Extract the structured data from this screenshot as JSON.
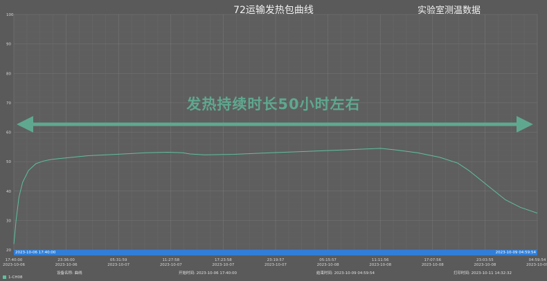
{
  "chart_data": {
    "type": "line",
    "title": "72运输发热包曲线",
    "subtitle": "实验室测温数据",
    "annotation": "发热持续时长50小时左右",
    "ylim": [
      20,
      100
    ],
    "y_ticks": [
      20,
      30,
      40,
      50,
      60,
      70,
      80,
      90,
      100
    ],
    "grid": true,
    "x_ticks": [
      {
        "time": "17:40:00",
        "date": "2023-10-06"
      },
      {
        "time": "23:36:00",
        "date": "2023-10-06"
      },
      {
        "time": "05:31:59",
        "date": "2023-10-07"
      },
      {
        "time": "11:27:58",
        "date": "2023-10-07"
      },
      {
        "time": "17:23:58",
        "date": "2023-10-07"
      },
      {
        "time": "23:19:57",
        "date": "2023-10-07"
      },
      {
        "time": "05:15:57",
        "date": "2023-10-08"
      },
      {
        "time": "11:11:56",
        "date": "2023-10-08"
      },
      {
        "time": "17:07:56",
        "date": "2023-10-08"
      },
      {
        "time": "23:03:55",
        "date": "2023-10-08"
      },
      {
        "time": "04:59:54",
        "date": "2023-10-09"
      }
    ],
    "series": [
      {
        "name": "1-CH08",
        "color": "#5fc0a0",
        "x_hours": [
          0,
          0.3,
          0.7,
          1.2,
          2,
          3,
          4,
          5,
          6,
          8,
          10,
          14,
          18,
          21,
          23,
          24,
          26,
          30,
          35,
          40,
          45,
          48,
          50,
          52,
          55,
          58,
          60.5,
          62,
          63,
          65,
          67,
          69,
          71.33
        ],
        "values": [
          22,
          30,
          38,
          43,
          47,
          49.3,
          50.2,
          50.7,
          51,
          51.5,
          52,
          52.5,
          53,
          53.2,
          53,
          52.6,
          52.3,
          52.5,
          53,
          53.5,
          54,
          54.3,
          54.5,
          54,
          53,
          51.5,
          49.5,
          47,
          45,
          41,
          37,
          34.5,
          32.5
        ]
      }
    ]
  },
  "range_bar": {
    "start": "2023-10-06 17:40:00",
    "end": "2023-10-09 04:59:54"
  },
  "footer": {
    "device": "设备名称: 曲线",
    "start": "开始时间: 2023-10-06 17:40:00",
    "end": "结束时间: 2023-10-09 04:59:54",
    "print": "打印时间: 2023-10-11 14:32:32"
  },
  "legend": {
    "label": "1-CH08"
  }
}
